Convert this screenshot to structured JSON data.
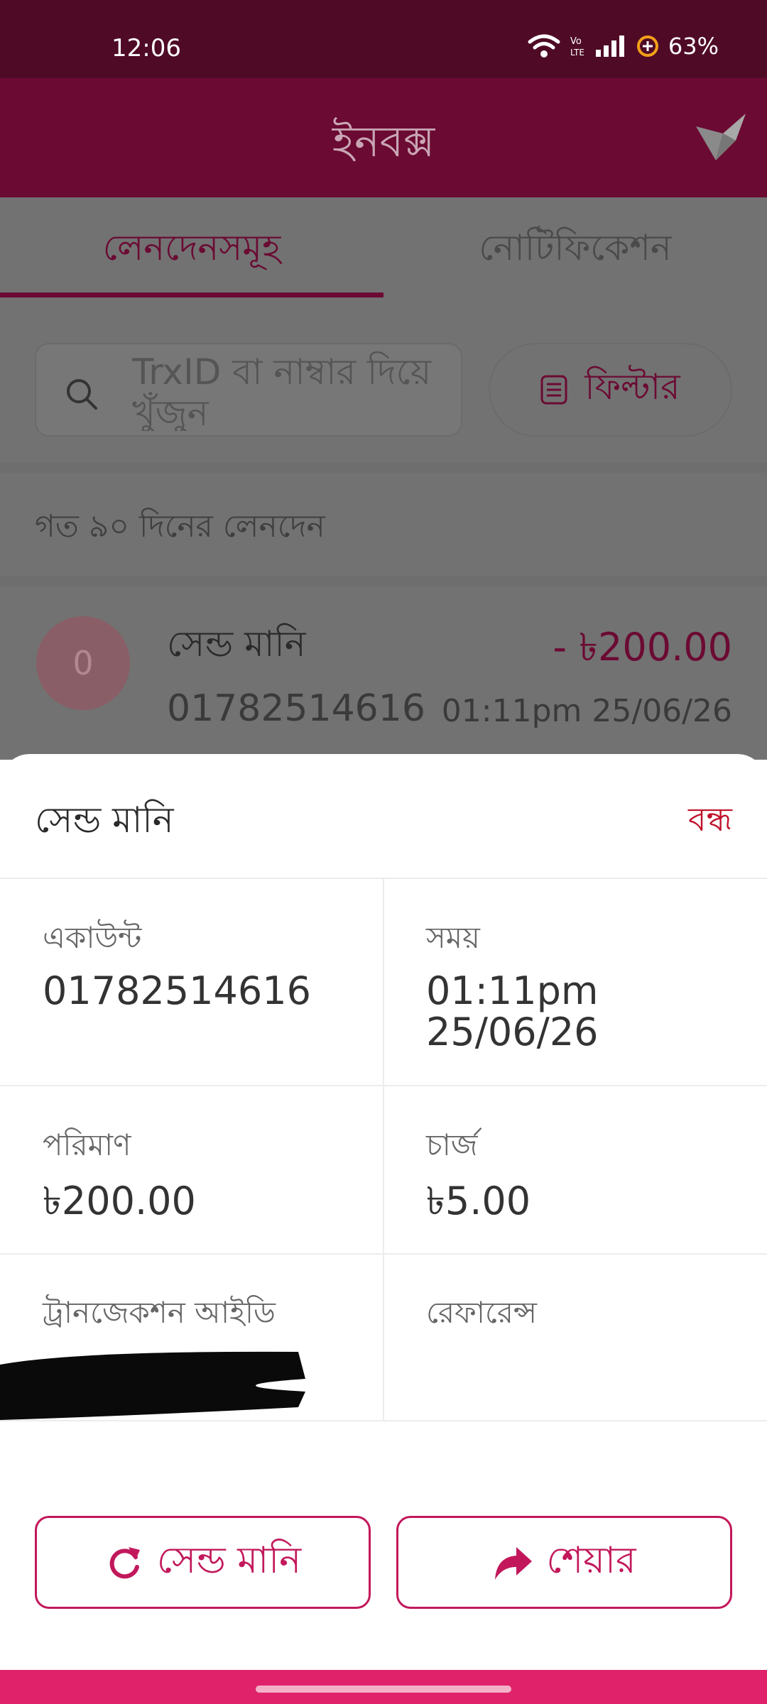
{
  "status_bar": {
    "time": "12:06",
    "battery": "63%"
  },
  "app_bar": {
    "title": "ইনবক্স"
  },
  "tabs": [
    {
      "label": "লেনদেনসমূহ",
      "active": true
    },
    {
      "label": "নোটিফিকেশন",
      "active": false
    }
  ],
  "search": {
    "placeholder": "TrxID বা নাম্বার দিয়ে খুঁজুন"
  },
  "filter": {
    "label": "ফিল্টার"
  },
  "recent_label": "গত ৯০ দিনের লেনদেন",
  "transaction": {
    "avatar_initial": "0",
    "name": "সেন্ড মানি",
    "number": "01782514616",
    "amount": "- ৳200.00",
    "time": "01:11pm 25/06/26"
  },
  "sheet": {
    "title": "সেন্ড মানি",
    "close_label": "বন্ধ",
    "account": {
      "label": "একাউন্ট",
      "value": "01782514616"
    },
    "time": {
      "label": "সময়",
      "value_line1": "01:11pm",
      "value_line2": "25/06/26"
    },
    "amount": {
      "label": "পরিমাণ",
      "value": "৳200.00"
    },
    "charge": {
      "label": "চার্জ",
      "value": "৳5.00"
    },
    "trx_id": {
      "label": "ট্রানজেকশন আইডি"
    },
    "reference": {
      "label": "রেফারেন্স"
    },
    "send_again_label": "সেন্ড মানি",
    "share_label": "শেয়ার"
  },
  "colors": {
    "primary": "#6b0a33",
    "status_bar": "#4f0a26",
    "accent": "#c2185b",
    "close_red": "#c0102a",
    "nav_bar": "#e0226a"
  }
}
